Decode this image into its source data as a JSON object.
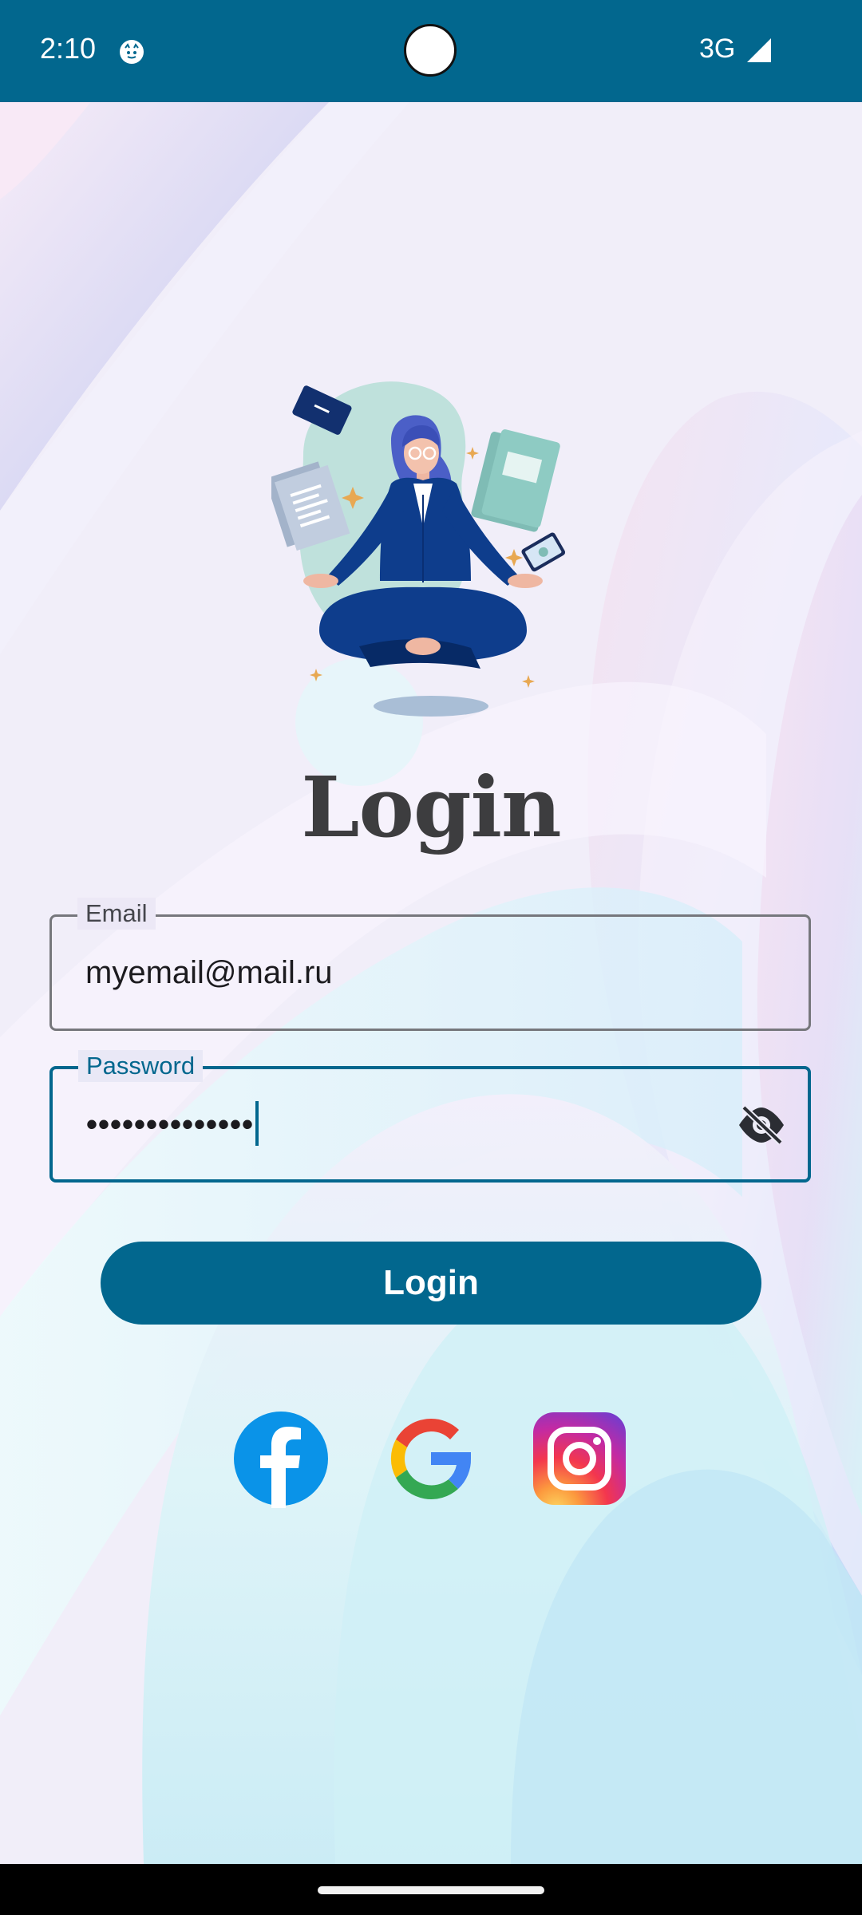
{
  "status_bar": {
    "time": "2:10",
    "network": "3G",
    "app_icon": "notification-app-icon",
    "signal_icon": "cell-signal-icon",
    "color": "#02678e"
  },
  "title": "Login",
  "email": {
    "label": "Email",
    "value": "myemail@mail.ru"
  },
  "password": {
    "label": "Password",
    "value": "••••••••••••••",
    "toggle_icon": "visibility-off-icon"
  },
  "login_button": {
    "label": "Login"
  },
  "social": [
    {
      "name": "facebook",
      "icon": "facebook-icon",
      "color": "#0a93e8"
    },
    {
      "name": "google",
      "icon": "google-icon",
      "color": "#4285f4"
    },
    {
      "name": "instagram",
      "icon": "instagram-icon",
      "color": "#c13584"
    }
  ],
  "colors": {
    "primary": "#02678e",
    "title": "#3d3d3f",
    "outline": "#76777c"
  }
}
